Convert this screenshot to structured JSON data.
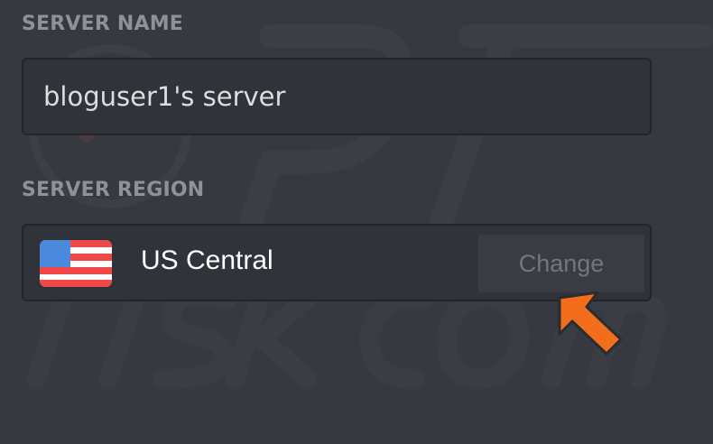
{
  "server_name": {
    "label": "SERVER NAME",
    "value": "bloguser1's server"
  },
  "server_region": {
    "label": "SERVER REGION",
    "region": "US Central",
    "flag_icon": "us-flag-icon",
    "change_label": "Change"
  },
  "colors": {
    "background": "#36393f",
    "field_background": "#303339",
    "label": "#8e9297",
    "button_text": "#72767d",
    "cursor_arrow": "#f26e1c"
  }
}
